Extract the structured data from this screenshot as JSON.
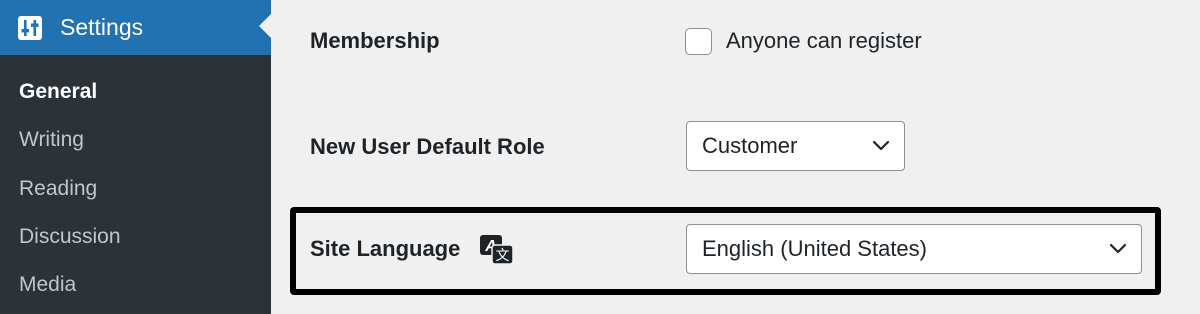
{
  "sidebar": {
    "header_label": "Settings",
    "header_icon": "settings-sliders-icon",
    "items": [
      {
        "label": "General",
        "current": true
      },
      {
        "label": "Writing"
      },
      {
        "label": "Reading"
      },
      {
        "label": "Discussion"
      },
      {
        "label": "Media"
      }
    ]
  },
  "form": {
    "membership": {
      "label": "Membership",
      "checkbox_label": "Anyone can register",
      "checked": false
    },
    "default_role": {
      "label": "New User Default Role",
      "selected": "Customer"
    },
    "site_language": {
      "label": "Site Language",
      "icon": "translate-icon",
      "selected": "English (United States)"
    }
  },
  "colors": {
    "sidebar_bg": "#2c3338",
    "sidebar_active_bg": "#2271b1",
    "content_bg": "#f0f0f1",
    "highlight_border": "#000000"
  }
}
